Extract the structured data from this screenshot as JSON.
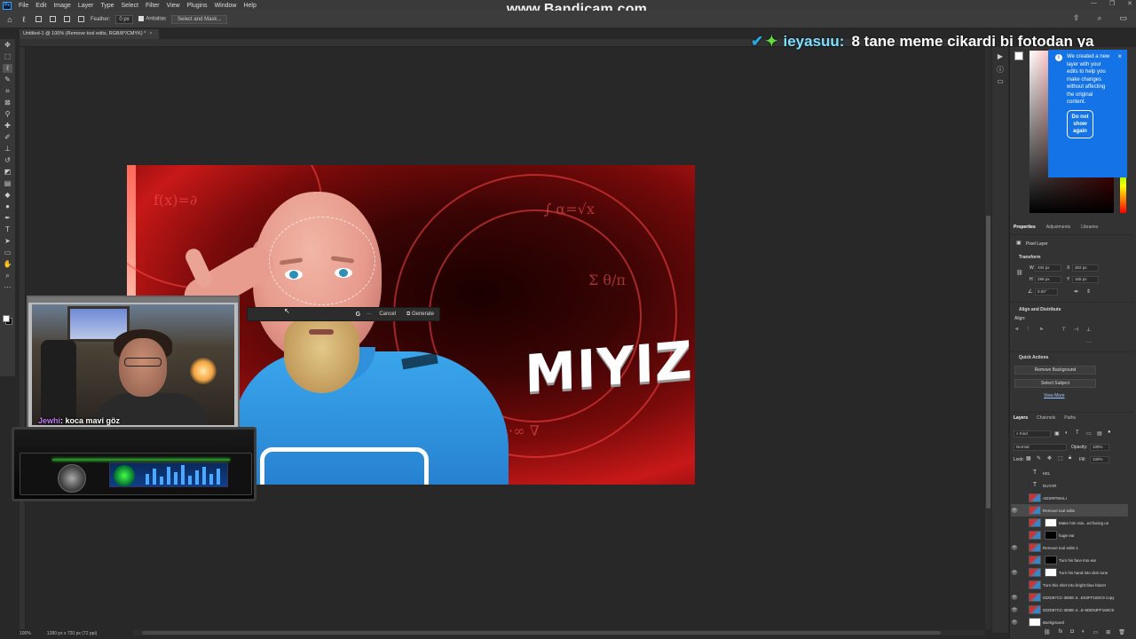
{
  "watermark": "www.Bandicam.com",
  "menu": {
    "logo": "Ps",
    "items": [
      "File",
      "Edit",
      "Image",
      "Layer",
      "Type",
      "Select",
      "Filter",
      "View",
      "Plugins",
      "Window",
      "Help"
    ]
  },
  "options_bar": {
    "feather_label": "Feather:",
    "feather_value": "0 px",
    "antialias_label": "Antialias",
    "select_mask_label": "Select and Mask..."
  },
  "document": {
    "tab_title": "Untitled-1 @ 100% (Remove tool edits, RGB/8*/CMYK) *",
    "zoom": "100%",
    "doc_size": "1280 px x 720 px (72 ppi)"
  },
  "canvas": {
    "title_text": "MIYIZ?"
  },
  "contextual_task_bar": {
    "cancel_label": "Cancel",
    "generate_label": "Generate"
  },
  "stream_chat": {
    "banner_user": "ieyasuu:",
    "banner_message": "8 tane meme cikardi bi fotodan ya",
    "webcam_user": "Jewhi",
    "webcam_message": ": koca mavi göz"
  },
  "tooltip": {
    "message": "We created a new layer with your edits to help you make changes without affecting the original content.",
    "button_label": "Do not show again"
  },
  "properties": {
    "tabs": [
      "Properties",
      "Adjustments",
      "Libraries"
    ],
    "layer_kind": "Pixel Layer",
    "transform_title": "Transform",
    "w_label": "W",
    "w_value": "334 px",
    "x_label": "X",
    "x_value": "302 px",
    "h_label": "H",
    "h_value": "299 px",
    "y_label": "Y",
    "y_value": "165 px",
    "angle_value": "0.00°",
    "align_title": "Align and Distribute",
    "align_label": "Align:",
    "quick_actions_title": "Quick Actions",
    "remove_bg_label": "Remove Background",
    "select_subject_label": "Select Subject",
    "view_more_label": "View More"
  },
  "layers_panel": {
    "tabs": [
      "Layers",
      "Channels",
      "Paths"
    ],
    "filter_label": "Kind",
    "blend_mode": "Normal",
    "opacity_label": "Opacity:",
    "opacity_value": "100%",
    "lock_label": "Lock:",
    "fill_label": "Fill:",
    "fill_value": "100%",
    "layers": [
      {
        "name": "KEL",
        "kind": "text",
        "visible": false
      },
      {
        "name": "DUYAR",
        "kind": "text",
        "visible": false
      },
      {
        "name": "ADSIRTMALI",
        "kind": "image",
        "visible": false
      },
      {
        "name": "Remove tool edits",
        "kind": "image",
        "visible": true
      },
      {
        "name": "Make him rais...ed facing us",
        "kind": "mask",
        "visible": false
      },
      {
        "name": "huge ear",
        "kind": "mask",
        "visible": false
      },
      {
        "name": "Remove tool edits 1",
        "kind": "image",
        "visible": true
      },
      {
        "name": "Turn his face into ear",
        "kind": "mask",
        "visible": false
      },
      {
        "name": "Turn his hand into skin tone",
        "kind": "mask",
        "visible": true
      },
      {
        "name": "Turn this shirt into bright blue blazer",
        "kind": "image",
        "visible": false
      },
      {
        "name": "022D87CC-3EBE-4...E53FF160C9 copy",
        "kind": "image",
        "visible": true
      },
      {
        "name": "022D87CC-3EBE-4...E-6DE53FF160C9",
        "kind": "image",
        "visible": true
      },
      {
        "name": "Background",
        "kind": "white",
        "visible": true
      }
    ]
  },
  "colors": {
    "app_bg": "#282828",
    "panel_bg": "#333333",
    "accent_blue": "#1473e6"
  }
}
